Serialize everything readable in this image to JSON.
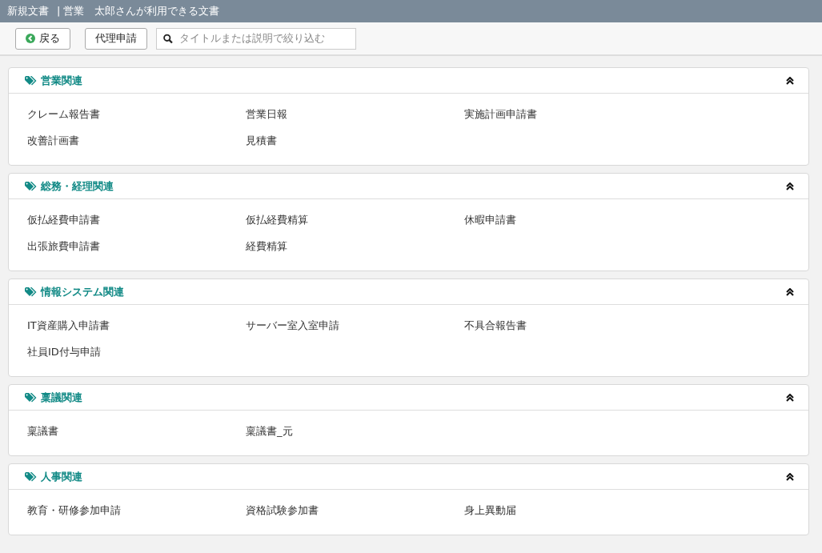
{
  "title_bar": {
    "title": "新規文書",
    "separator": "|",
    "subtitle": "営業　太郎さんが利用できる文書"
  },
  "toolbar": {
    "back_button": "戻る",
    "proxy_button": "代理申請",
    "search": {
      "placeholder": "タイトルまたは説明で絞り込む"
    }
  },
  "categories": [
    {
      "title": "営業関連",
      "expanded": true,
      "documents": [
        "クレーム報告書",
        "営業日報",
        "実施計画申請書",
        "改善計画書",
        "見積書"
      ]
    },
    {
      "title": "総務・経理関連",
      "expanded": true,
      "documents": [
        "仮払経費申請書",
        "仮払経費精算",
        "休暇申請書",
        "出張旅費申請書",
        "経費精算"
      ]
    },
    {
      "title": "情報システム関連",
      "expanded": true,
      "documents": [
        "IT資産購入申請書",
        "サーバー室入室申請",
        "不具合報告書",
        "社員ID付与申請"
      ]
    },
    {
      "title": "稟議関連",
      "expanded": true,
      "documents": [
        "稟議書",
        "稟議書_元"
      ]
    },
    {
      "title": "人事関連",
      "expanded": true,
      "documents": [
        "教育・研修参加申請",
        "資格試験参加書",
        "身上異動届"
      ]
    }
  ]
}
